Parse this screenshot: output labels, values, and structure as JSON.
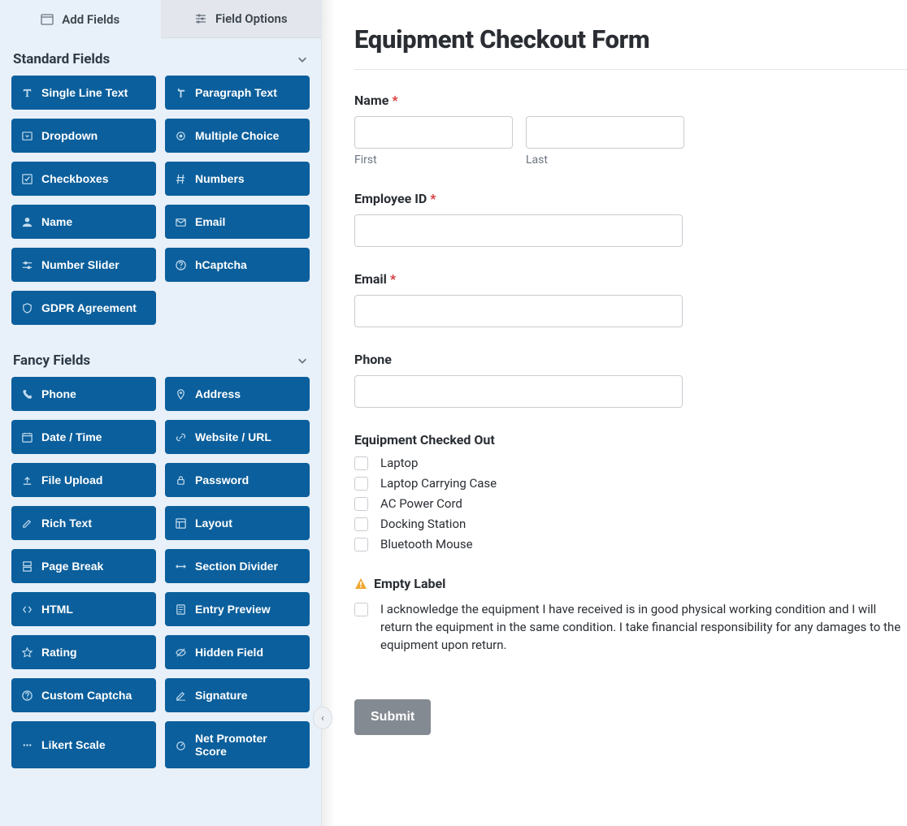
{
  "tabs": {
    "add_fields": "Add Fields",
    "field_options": "Field Options"
  },
  "sections": {
    "standard": {
      "title": "Standard Fields",
      "items": [
        {
          "icon": "text-icon",
          "label": "Single Line Text"
        },
        {
          "icon": "paragraph-icon",
          "label": "Paragraph Text"
        },
        {
          "icon": "dropdown-icon",
          "label": "Dropdown"
        },
        {
          "icon": "radio-icon",
          "label": "Multiple Choice"
        },
        {
          "icon": "check-icon",
          "label": "Checkboxes"
        },
        {
          "icon": "hash-icon",
          "label": "Numbers"
        },
        {
          "icon": "user-icon",
          "label": "Name"
        },
        {
          "icon": "mail-icon",
          "label": "Email"
        },
        {
          "icon": "slider-icon",
          "label": "Number Slider"
        },
        {
          "icon": "question-icon",
          "label": "hCaptcha"
        },
        {
          "icon": "shield-icon",
          "label": "GDPR Agreement"
        }
      ]
    },
    "fancy": {
      "title": "Fancy Fields",
      "items": [
        {
          "icon": "phone-icon",
          "label": "Phone"
        },
        {
          "icon": "pin-icon",
          "label": "Address"
        },
        {
          "icon": "calendar-icon",
          "label": "Date / Time"
        },
        {
          "icon": "link-icon",
          "label": "Website / URL"
        },
        {
          "icon": "upload-icon",
          "label": "File Upload"
        },
        {
          "icon": "lock-icon",
          "label": "Password"
        },
        {
          "icon": "edit-icon",
          "label": "Rich Text"
        },
        {
          "icon": "layout-icon",
          "label": "Layout"
        },
        {
          "icon": "pagebreak-icon",
          "label": "Page Break"
        },
        {
          "icon": "divider-icon",
          "label": "Section Divider"
        },
        {
          "icon": "code-icon",
          "label": "HTML"
        },
        {
          "icon": "preview-icon",
          "label": "Entry Preview"
        },
        {
          "icon": "star-icon",
          "label": "Rating"
        },
        {
          "icon": "hidden-icon",
          "label": "Hidden Field"
        },
        {
          "icon": "question-icon",
          "label": "Custom Captcha"
        },
        {
          "icon": "sign-icon",
          "label": "Signature"
        },
        {
          "icon": "likert-icon",
          "label": "Likert Scale"
        },
        {
          "icon": "nps-icon",
          "label": "Net Promoter Score"
        }
      ]
    }
  },
  "form": {
    "title": "Equipment Checkout Form",
    "fields": {
      "name": {
        "label": "Name",
        "required": true,
        "first_sub": "First",
        "last_sub": "Last"
      },
      "employee_id": {
        "label": "Employee ID",
        "required": true
      },
      "email": {
        "label": "Email",
        "required": true
      },
      "phone": {
        "label": "Phone",
        "required": false
      },
      "equipment": {
        "label": "Equipment Checked Out",
        "options": [
          "Laptop",
          "Laptop Carrying Case",
          "AC Power Cord",
          "Docking Station",
          "Bluetooth Mouse"
        ]
      },
      "acknowledge": {
        "empty_label": "Empty Label",
        "text": "I acknowledge the equipment I have received is in good physical working condition and I will return the equipment in the same condition. I take financial responsibility for any damages to the equipment upon return."
      }
    },
    "submit": "Submit"
  }
}
